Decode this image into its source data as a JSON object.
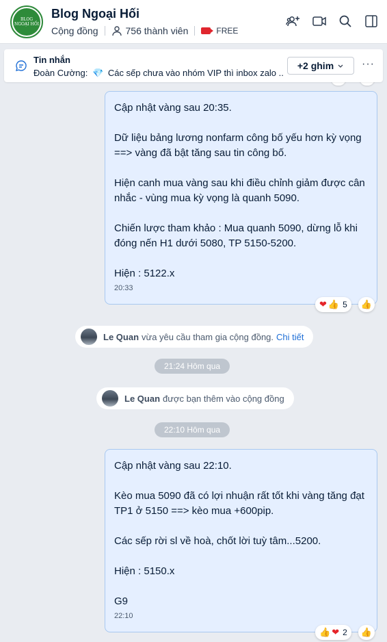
{
  "header": {
    "title": "Blog Ngoại Hối",
    "avatar_text_top": "BLOG",
    "avatar_text_bottom": "NGOẠI HỐI",
    "community_label": "Cộng đồng",
    "members": "756 thành viên",
    "plan": "FREE",
    "icons": [
      "add-member-icon",
      "video-call-icon",
      "search-icon",
      "sidebar-toggle-icon"
    ]
  },
  "pinned": {
    "title": "Tin nhắn",
    "sender": "Đoàn Cường:",
    "message": "Các sếp chưa vào nhóm VIP thì inbox zalo ...",
    "pin_count_label": "+2 ghim",
    "more": "···"
  },
  "messages": [
    {
      "lines": [
        "Cập nhật vàng sau 20:35.",
        "",
        "Dữ liệu bảng lương nonfarm công bố yếu hơn kỳ vọng",
        "==> vàng đã bật tăng sau tin công bố.",
        "",
        "Hiện canh mua vàng sau khi điều chỉnh giảm được cân",
        "nhắc - vùng mua kỳ vọng là quanh 5090.",
        "",
        "Chiến lược tham khảo : Mua quanh 5090, dừng lỗ khi",
        "đóng nến H1 dưới 5080, TP 5150-5200.",
        "",
        "Hiện : 5122.x"
      ],
      "time": "20:33",
      "reaction_count": "5"
    },
    {
      "lines": [
        "Cập nhật vàng sau 22:10.",
        "",
        "Kèo mua 5090 đã có lợi nhuận rất tốt khi vàng tăng đạt",
        "TP1 ở 5150 ==> kèo mua +600pip.",
        "",
        "Các sếp rời sl về hoà, chốt lời tuỳ tâm...5200.",
        "",
        "Hiện : 5150.x",
        "",
        "G9"
      ],
      "time": "22:10",
      "reaction_count": "2"
    }
  ],
  "notices": [
    {
      "name": "Le Quan",
      "text": "vừa yêu cầu tham gia cộng đồng.",
      "link": "Chi tiết"
    },
    {
      "name": "Le Quan",
      "text": "được bạn thêm vào cộng đồng"
    }
  ],
  "time_chips": [
    "21:24 Hôm qua",
    "22:10 Hôm qua"
  ],
  "colors": {
    "bubble_bg": "#e5efff",
    "bubble_border": "#a8c8f0",
    "link": "#1f6fd6",
    "free_tag": "#e0262e",
    "avatar_green": "#2e8b3a"
  }
}
